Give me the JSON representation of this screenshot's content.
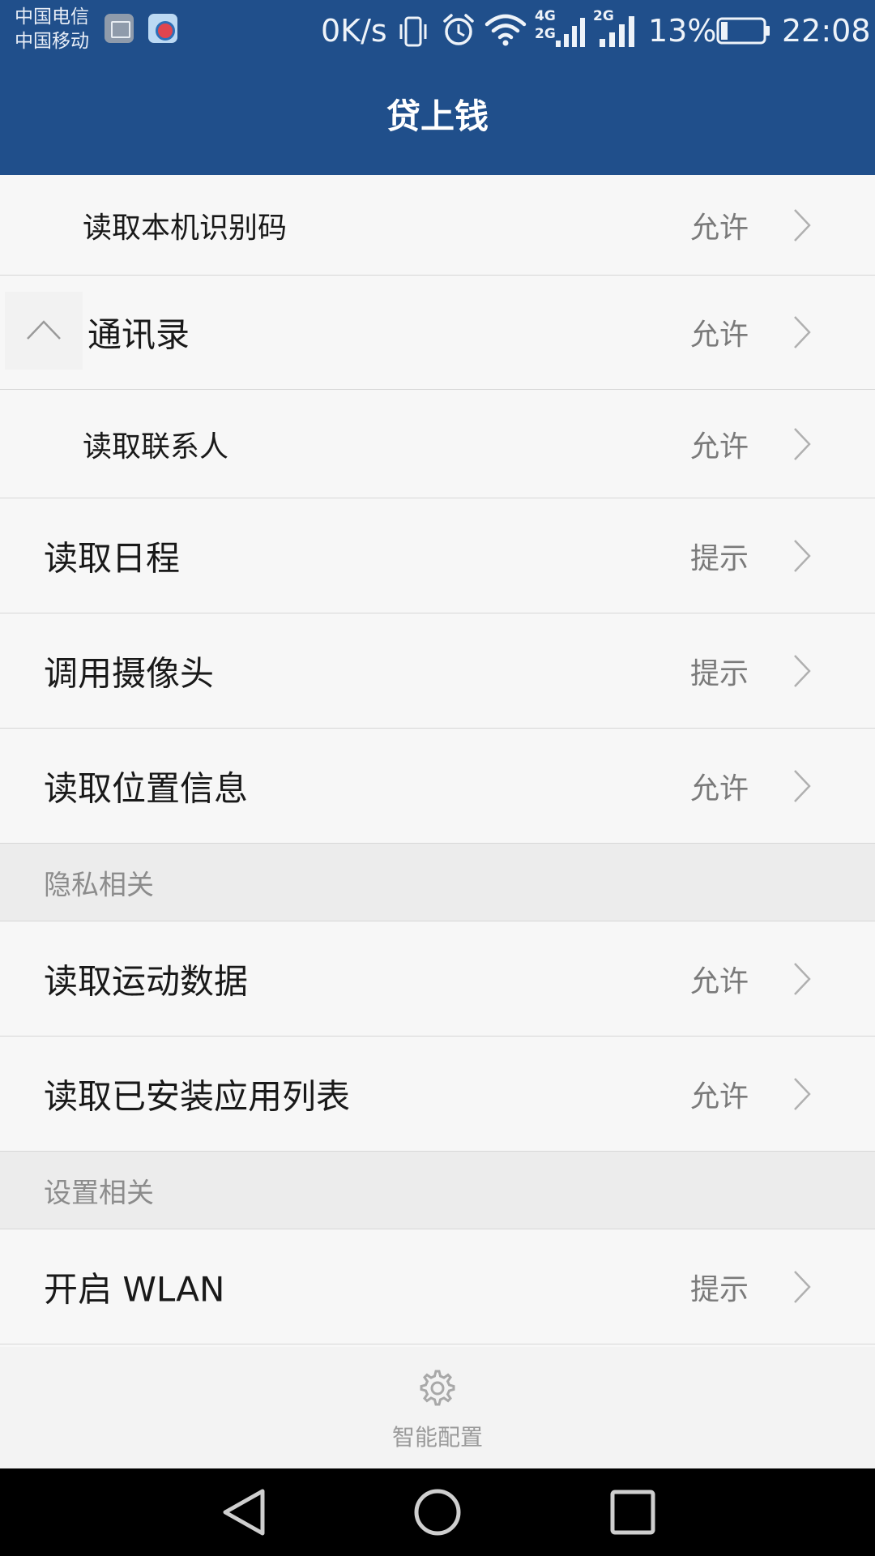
{
  "status_bar": {
    "carrier_1": "中国电信",
    "carrier_2": "中国移动",
    "net_speed": "0K/s",
    "signal_4g_label": "4G",
    "signal_2g_label_a": "2G",
    "signal_2g_label_b": "2G",
    "battery_percent": "13%",
    "battery_level": 0.13,
    "time": "22:08",
    "icons": [
      "gallery-icon",
      "video-icon",
      "vibrate-icon",
      "alarm-icon",
      "wifi-icon",
      "signal-4g-icon",
      "signal-2g-icon",
      "battery-icon"
    ]
  },
  "header": {
    "title": "贷上钱"
  },
  "permissions": {
    "items": [
      {
        "label": "读取本机识别码",
        "status": "允许"
      },
      {
        "label": "通讯录",
        "status": "允许"
      },
      {
        "label": "读取联系人",
        "status": "允许"
      },
      {
        "label": "读取日程",
        "status": "提示"
      },
      {
        "label": "调用摄像头",
        "status": "提示"
      },
      {
        "label": "读取位置信息",
        "status": "允许"
      }
    ],
    "privacy_section": "隐私相关",
    "privacy_items": [
      {
        "label": "读取运动数据",
        "status": "允许"
      },
      {
        "label": "读取已安装应用列表",
        "status": "允许"
      }
    ],
    "settings_section": "设置相关",
    "settings_items": [
      {
        "label": "开启 WLAN",
        "status": "提示"
      }
    ]
  },
  "bottom": {
    "smart_config_label": "智能配置"
  },
  "colors": {
    "brand_blue": "#204f8b",
    "list_bg": "#f7f7f7",
    "section_bg": "#ececec",
    "status_text": "#7a7a7a"
  }
}
